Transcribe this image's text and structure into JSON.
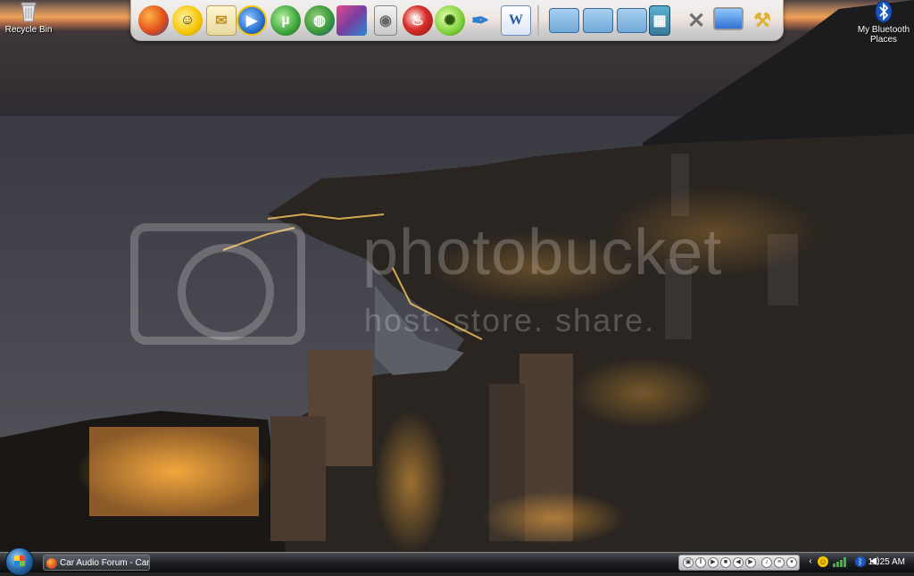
{
  "desktop": {
    "icons": [
      {
        "label": "Recycle Bin",
        "icon": "recycle-bin-icon"
      },
      {
        "label": "My Bluetooth Places",
        "icon": "bluetooth-icon"
      }
    ],
    "watermark": {
      "brand": "photobucket",
      "tagline": "host. store. share."
    }
  },
  "dock": {
    "items": [
      {
        "icon": "firefox-icon",
        "color": "#e2661b"
      },
      {
        "icon": "messenger-icon",
        "color": "#f5c400"
      },
      {
        "icon": "mail-icon",
        "color": "#e8d9a0"
      },
      {
        "icon": "media-player-icon",
        "color": "#2a6fd0"
      },
      {
        "icon": "utorrent-icon",
        "color": "#3aa33a"
      },
      {
        "icon": "globe-icon",
        "color": "#3b9a3b"
      },
      {
        "icon": "photo-app-icon",
        "color": "#7a3fa0"
      },
      {
        "icon": "ipod-icon",
        "color": "#d8d8d8"
      },
      {
        "icon": "nero-icon",
        "color": "#d8302a"
      },
      {
        "icon": "limewire-icon",
        "color": "#7fd03a"
      },
      {
        "icon": "quill-icon",
        "color": "#2f7fd0"
      },
      {
        "icon": "word-icon",
        "color": "#2a5aa8"
      },
      {
        "icon": "folder-icon",
        "color": "#6fa8d8"
      },
      {
        "icon": "documents-folder-icon",
        "color": "#6fa8d8"
      },
      {
        "icon": "pictures-folder-icon",
        "color": "#6fa8d8"
      },
      {
        "icon": "film-icon",
        "color": "#3a7a9a"
      },
      {
        "icon": "tools-icon",
        "color": "#909090"
      },
      {
        "icon": "monitor-icon",
        "color": "#2f6fd0"
      },
      {
        "icon": "settings-wand-icon",
        "color": "#e0b030"
      }
    ]
  },
  "taskbar": {
    "task_label": "Car Audio Forum - Car...",
    "clock": "11:25 AM",
    "tray_icons": [
      "chevron-left-icon",
      "messenger-tray-icon",
      "signal-icon",
      "bluetooth-tray-icon",
      "volume-icon"
    ]
  }
}
